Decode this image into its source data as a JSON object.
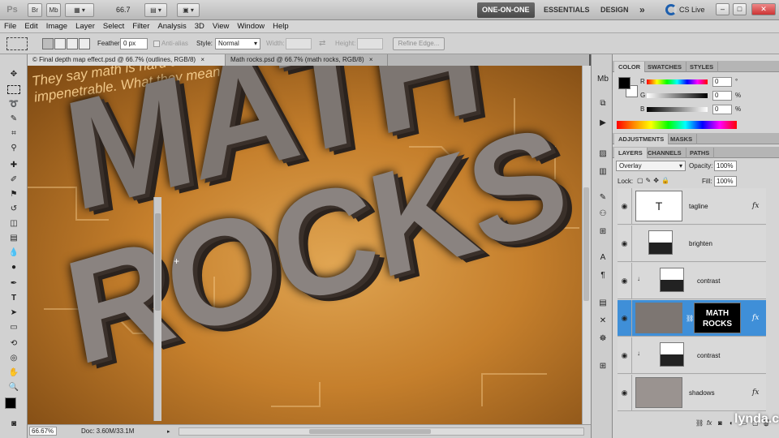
{
  "app": {
    "logo": "Ps",
    "bridge_label": "Br",
    "minibridge_label": "Mb",
    "zoom": "66.7",
    "workspaces": [
      "ONE-ON-ONE",
      "ESSENTIALS",
      "DESIGN"
    ],
    "more_label": "»",
    "cslive": "CS Live",
    "window_controls": [
      "–",
      "□",
      "✕"
    ]
  },
  "menu": [
    "File",
    "Edit",
    "Image",
    "Layer",
    "Select",
    "Filter",
    "Analysis",
    "3D",
    "View",
    "Window",
    "Help"
  ],
  "options": {
    "feather_label": "Feather:",
    "feather_value": "0 px",
    "antialias_label": "Anti-alias",
    "style_label": "Style:",
    "style_value": "Normal",
    "width_label": "Width:",
    "height_label": "Height:",
    "refine_label": "Refine Edge..."
  },
  "tabs": [
    {
      "label": "© Final depth map effect.psd @ 66.7% (outlines, RGB/8)",
      "close": "×"
    },
    {
      "label": "Math rocks.psd @ 66.7% (math rocks, RGB/8)",
      "close": "×"
    }
  ],
  "canvas": {
    "tagline_line1": "They say math is hard and",
    "tagline_line2": "impenetrable. What they mean is:",
    "word1": "MATH",
    "word2": "ROCKS"
  },
  "status": {
    "zoom": "66.67%",
    "doc": "Doc: 3.60M/33.1M"
  },
  "color_panel": {
    "tabs": [
      "COLOR",
      "SWATCHES",
      "STYLES"
    ],
    "channels": [
      {
        "label": "R",
        "value": "0"
      },
      {
        "label": "G",
        "value": "0"
      },
      {
        "label": "B",
        "value": "0"
      }
    ],
    "degree": "°",
    "percent": "%",
    "foreground": "#000000",
    "background": "#ffffff"
  },
  "adjust_panel": {
    "tabs": [
      "ADJUSTMENTS",
      "MASKS"
    ]
  },
  "layers_panel": {
    "tabs": [
      "LAYERS",
      "CHANNELS",
      "PATHS"
    ],
    "blend_mode": "Overlay",
    "opacity_label": "Opacity:",
    "opacity_value": "100%",
    "lock_label": "Lock:",
    "fill_label": "Fill:",
    "fill_value": "100%",
    "layers": [
      {
        "name": "tagline",
        "fx": "fx"
      },
      {
        "name": "brighten",
        "fx": ""
      },
      {
        "name": "contrast",
        "fx": ""
      },
      {
        "name": "",
        "fx": "fx"
      },
      {
        "name": "contrast",
        "fx": ""
      },
      {
        "name": "shadows",
        "fx": "fx"
      }
    ],
    "thumb_text": "MATH ROCKS",
    "thumb_T": "T"
  },
  "watermark": "lynda.com",
  "colors": {
    "accent": "#3f8fd8",
    "tagline": "#f2c98a",
    "rock": "#7d7672"
  }
}
